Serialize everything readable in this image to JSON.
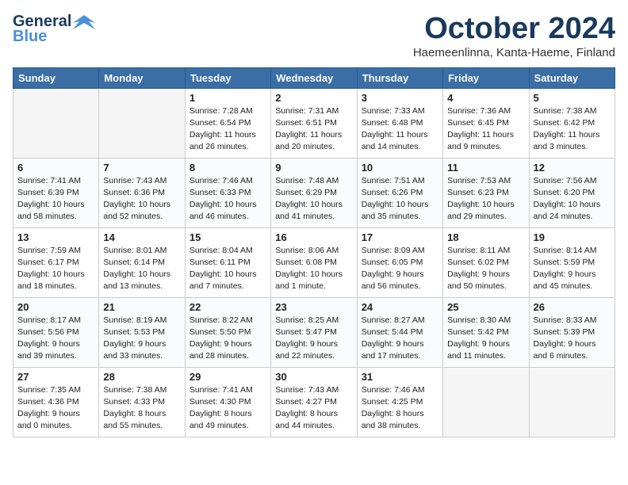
{
  "header": {
    "logo_line1": "General",
    "logo_line2": "Blue",
    "month": "October 2024",
    "location": "Haemeenlinna, Kanta-Haeme, Finland"
  },
  "weekdays": [
    "Sunday",
    "Monday",
    "Tuesday",
    "Wednesday",
    "Thursday",
    "Friday",
    "Saturday"
  ],
  "weeks": [
    [
      {
        "day": "",
        "empty": true
      },
      {
        "day": "",
        "empty": true
      },
      {
        "day": "1",
        "sunrise": "Sunrise: 7:28 AM",
        "sunset": "Sunset: 6:54 PM",
        "daylight": "Daylight: 11 hours and 26 minutes."
      },
      {
        "day": "2",
        "sunrise": "Sunrise: 7:31 AM",
        "sunset": "Sunset: 6:51 PM",
        "daylight": "Daylight: 11 hours and 20 minutes."
      },
      {
        "day": "3",
        "sunrise": "Sunrise: 7:33 AM",
        "sunset": "Sunset: 6:48 PM",
        "daylight": "Daylight: 11 hours and 14 minutes."
      },
      {
        "day": "4",
        "sunrise": "Sunrise: 7:36 AM",
        "sunset": "Sunset: 6:45 PM",
        "daylight": "Daylight: 11 hours and 9 minutes."
      },
      {
        "day": "5",
        "sunrise": "Sunrise: 7:38 AM",
        "sunset": "Sunset: 6:42 PM",
        "daylight": "Daylight: 11 hours and 3 minutes."
      }
    ],
    [
      {
        "day": "6",
        "sunrise": "Sunrise: 7:41 AM",
        "sunset": "Sunset: 6:39 PM",
        "daylight": "Daylight: 10 hours and 58 minutes."
      },
      {
        "day": "7",
        "sunrise": "Sunrise: 7:43 AM",
        "sunset": "Sunset: 6:36 PM",
        "daylight": "Daylight: 10 hours and 52 minutes."
      },
      {
        "day": "8",
        "sunrise": "Sunrise: 7:46 AM",
        "sunset": "Sunset: 6:33 PM",
        "daylight": "Daylight: 10 hours and 46 minutes."
      },
      {
        "day": "9",
        "sunrise": "Sunrise: 7:48 AM",
        "sunset": "Sunset: 6:29 PM",
        "daylight": "Daylight: 10 hours and 41 minutes."
      },
      {
        "day": "10",
        "sunrise": "Sunrise: 7:51 AM",
        "sunset": "Sunset: 6:26 PM",
        "daylight": "Daylight: 10 hours and 35 minutes."
      },
      {
        "day": "11",
        "sunrise": "Sunrise: 7:53 AM",
        "sunset": "Sunset: 6:23 PM",
        "daylight": "Daylight: 10 hours and 29 minutes."
      },
      {
        "day": "12",
        "sunrise": "Sunrise: 7:56 AM",
        "sunset": "Sunset: 6:20 PM",
        "daylight": "Daylight: 10 hours and 24 minutes."
      }
    ],
    [
      {
        "day": "13",
        "sunrise": "Sunrise: 7:59 AM",
        "sunset": "Sunset: 6:17 PM",
        "daylight": "Daylight: 10 hours and 18 minutes."
      },
      {
        "day": "14",
        "sunrise": "Sunrise: 8:01 AM",
        "sunset": "Sunset: 6:14 PM",
        "daylight": "Daylight: 10 hours and 13 minutes."
      },
      {
        "day": "15",
        "sunrise": "Sunrise: 8:04 AM",
        "sunset": "Sunset: 6:11 PM",
        "daylight": "Daylight: 10 hours and 7 minutes."
      },
      {
        "day": "16",
        "sunrise": "Sunrise: 8:06 AM",
        "sunset": "Sunset: 6:08 PM",
        "daylight": "Daylight: 10 hours and 1 minute."
      },
      {
        "day": "17",
        "sunrise": "Sunrise: 8:09 AM",
        "sunset": "Sunset: 6:05 PM",
        "daylight": "Daylight: 9 hours and 56 minutes."
      },
      {
        "day": "18",
        "sunrise": "Sunrise: 8:11 AM",
        "sunset": "Sunset: 6:02 PM",
        "daylight": "Daylight: 9 hours and 50 minutes."
      },
      {
        "day": "19",
        "sunrise": "Sunrise: 8:14 AM",
        "sunset": "Sunset: 5:59 PM",
        "daylight": "Daylight: 9 hours and 45 minutes."
      }
    ],
    [
      {
        "day": "20",
        "sunrise": "Sunrise: 8:17 AM",
        "sunset": "Sunset: 5:56 PM",
        "daylight": "Daylight: 9 hours and 39 minutes."
      },
      {
        "day": "21",
        "sunrise": "Sunrise: 8:19 AM",
        "sunset": "Sunset: 5:53 PM",
        "daylight": "Daylight: 9 hours and 33 minutes."
      },
      {
        "day": "22",
        "sunrise": "Sunrise: 8:22 AM",
        "sunset": "Sunset: 5:50 PM",
        "daylight": "Daylight: 9 hours and 28 minutes."
      },
      {
        "day": "23",
        "sunrise": "Sunrise: 8:25 AM",
        "sunset": "Sunset: 5:47 PM",
        "daylight": "Daylight: 9 hours and 22 minutes."
      },
      {
        "day": "24",
        "sunrise": "Sunrise: 8:27 AM",
        "sunset": "Sunset: 5:44 PM",
        "daylight": "Daylight: 9 hours and 17 minutes."
      },
      {
        "day": "25",
        "sunrise": "Sunrise: 8:30 AM",
        "sunset": "Sunset: 5:42 PM",
        "daylight": "Daylight: 9 hours and 11 minutes."
      },
      {
        "day": "26",
        "sunrise": "Sunrise: 8:33 AM",
        "sunset": "Sunset: 5:39 PM",
        "daylight": "Daylight: 9 hours and 6 minutes."
      }
    ],
    [
      {
        "day": "27",
        "sunrise": "Sunrise: 7:35 AM",
        "sunset": "Sunset: 4:36 PM",
        "daylight": "Daylight: 9 hours and 0 minutes."
      },
      {
        "day": "28",
        "sunrise": "Sunrise: 7:38 AM",
        "sunset": "Sunset: 4:33 PM",
        "daylight": "Daylight: 8 hours and 55 minutes."
      },
      {
        "day": "29",
        "sunrise": "Sunrise: 7:41 AM",
        "sunset": "Sunset: 4:30 PM",
        "daylight": "Daylight: 8 hours and 49 minutes."
      },
      {
        "day": "30",
        "sunrise": "Sunrise: 7:43 AM",
        "sunset": "Sunset: 4:27 PM",
        "daylight": "Daylight: 8 hours and 44 minutes."
      },
      {
        "day": "31",
        "sunrise": "Sunrise: 7:46 AM",
        "sunset": "Sunset: 4:25 PM",
        "daylight": "Daylight: 8 hours and 38 minutes."
      },
      {
        "day": "",
        "empty": true
      },
      {
        "day": "",
        "empty": true
      }
    ]
  ]
}
